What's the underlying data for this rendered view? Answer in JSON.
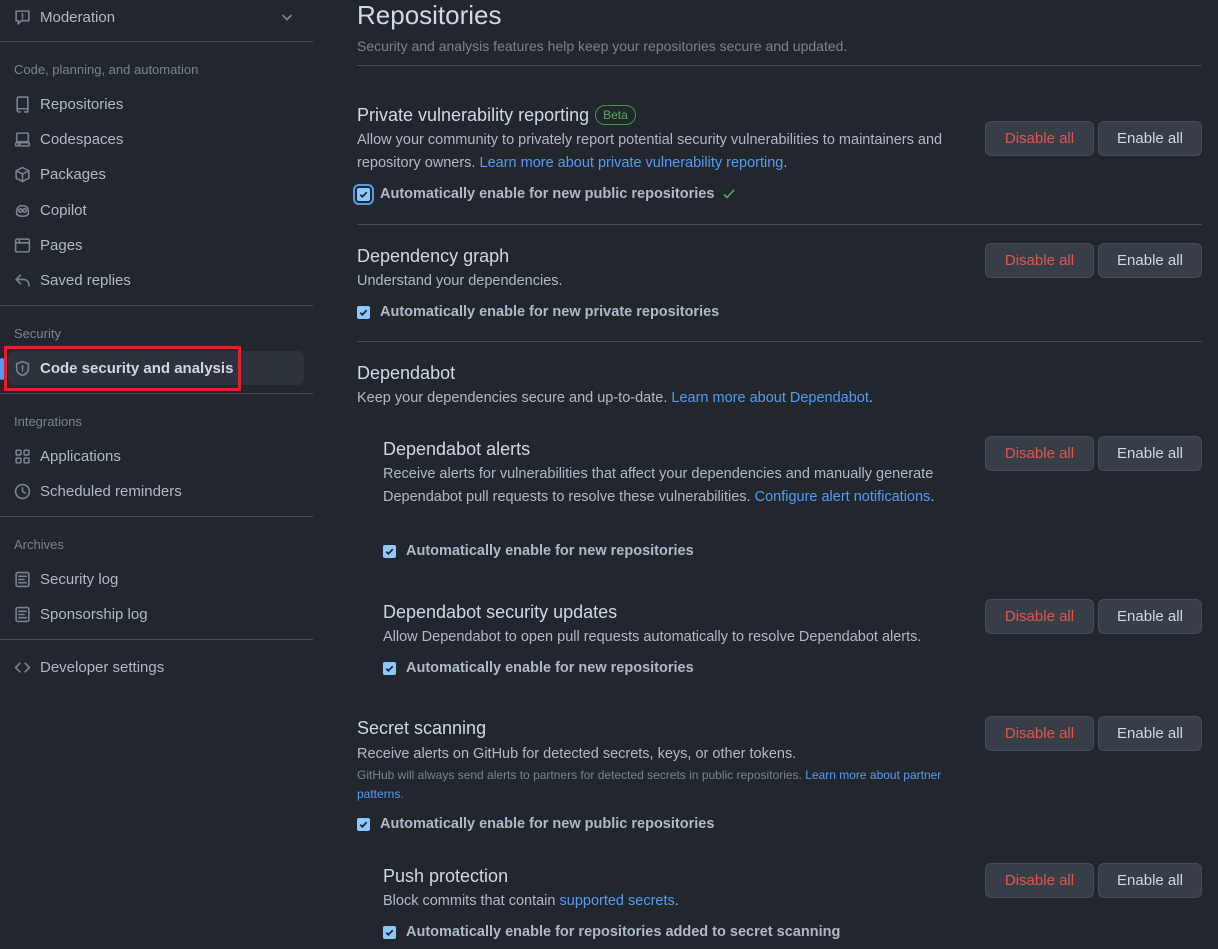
{
  "sidebar": {
    "moderation": "Moderation",
    "group_code": "Code, planning, and automation",
    "repositories": "Repositories",
    "codespaces": "Codespaces",
    "packages": "Packages",
    "copilot": "Copilot",
    "pages": "Pages",
    "saved_replies": "Saved replies",
    "group_security": "Security",
    "code_security": "Code security and analysis",
    "group_integrations": "Integrations",
    "applications": "Applications",
    "scheduled_reminders": "Scheduled reminders",
    "group_archives": "Archives",
    "security_log": "Security log",
    "sponsorship_log": "Sponsorship log",
    "developer_settings": "Developer settings"
  },
  "main": {
    "title": "Repositories",
    "description": "Security and analysis features help keep your repositories secure and updated.",
    "disable_label": "Disable all",
    "enable_label": "Enable all",
    "pvr": {
      "title": "Private vulnerability reporting",
      "badge": "Beta",
      "desc": "Allow your community to privately report potential security vulnerabilities to maintainers and repository owners. ",
      "link": "Learn more about private vulnerability reporting",
      "link_suffix": ".",
      "checkbox": "Automatically enable for new public repositories"
    },
    "dep_graph": {
      "title": "Dependency graph",
      "desc": "Understand your dependencies.",
      "checkbox": "Automatically enable for new private repositories"
    },
    "dependabot": {
      "title": "Dependabot",
      "desc": "Keep your dependencies secure and up-to-date. ",
      "link": "Learn more about Dependabot",
      "link_suffix": "."
    },
    "dep_alerts": {
      "title": "Dependabot alerts",
      "desc": "Receive alerts for vulnerabilities that affect your dependencies and manually generate Dependabot pull requests to resolve these vulnerabilities. ",
      "link": "Configure alert notifications",
      "link_suffix": ".",
      "checkbox": "Automatically enable for new repositories"
    },
    "dep_updates": {
      "title": "Dependabot security updates",
      "desc": "Allow Dependabot to open pull requests automatically to resolve Dependabot alerts.",
      "checkbox": "Automatically enable for new repositories"
    },
    "secret_scanning": {
      "title": "Secret scanning",
      "desc": "Receive alerts on GitHub for detected secrets, keys, or other tokens.",
      "note": "GitHub will always send alerts to partners for detected secrets in public repositories. ",
      "note_link": "Learn more about partner patterns",
      "note_suffix": ".",
      "checkbox": "Automatically enable for new public repositories"
    },
    "push_protection": {
      "title": "Push protection",
      "desc": "Block commits that contain ",
      "link": "supported secrets",
      "link_suffix": ".",
      "checkbox": "Automatically enable for repositories added to secret scanning"
    }
  }
}
